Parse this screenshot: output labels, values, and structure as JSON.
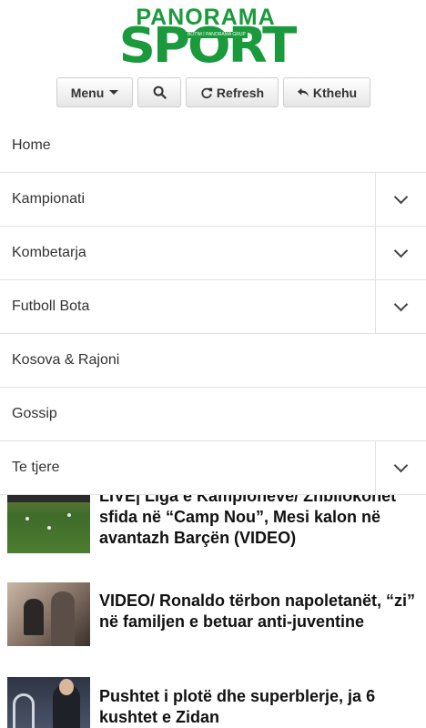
{
  "logo": {
    "top": "PANORAMA",
    "main": "SPORT",
    "tagline": "BOTIM I PANORAMA GRUP"
  },
  "toolbar": {
    "menu_label": "Menu",
    "refresh_label": "Refresh",
    "back_label": "Kthehu"
  },
  "menu": {
    "items": [
      {
        "label": "Home",
        "has_submenu": false
      },
      {
        "label": "Kampionati",
        "has_submenu": true
      },
      {
        "label": "Kombetarja",
        "has_submenu": true
      },
      {
        "label": "Futboll Bota",
        "has_submenu": true
      },
      {
        "label": "Kosova & Rajoni",
        "has_submenu": false
      },
      {
        "label": "Gossip",
        "has_submenu": false
      },
      {
        "label": "Te tjere",
        "has_submenu": true
      }
    ]
  },
  "articles": [
    {
      "title": "LIVE| Liga e Kampioneve/ Zhbllokohet sfida në “Camp Nou”, Mesi kalon në avantazh Barçën (VIDEO)"
    },
    {
      "title": "VIDEO/ Ronaldo tërbon napoletanët, “zi” në familjen e betuar anti-juventine"
    },
    {
      "title": "Pushtet i plotë dhe superblerje, ja 6 kushtet e Zidan"
    }
  ],
  "colors": {
    "brand_green": "#1a9a3c"
  }
}
